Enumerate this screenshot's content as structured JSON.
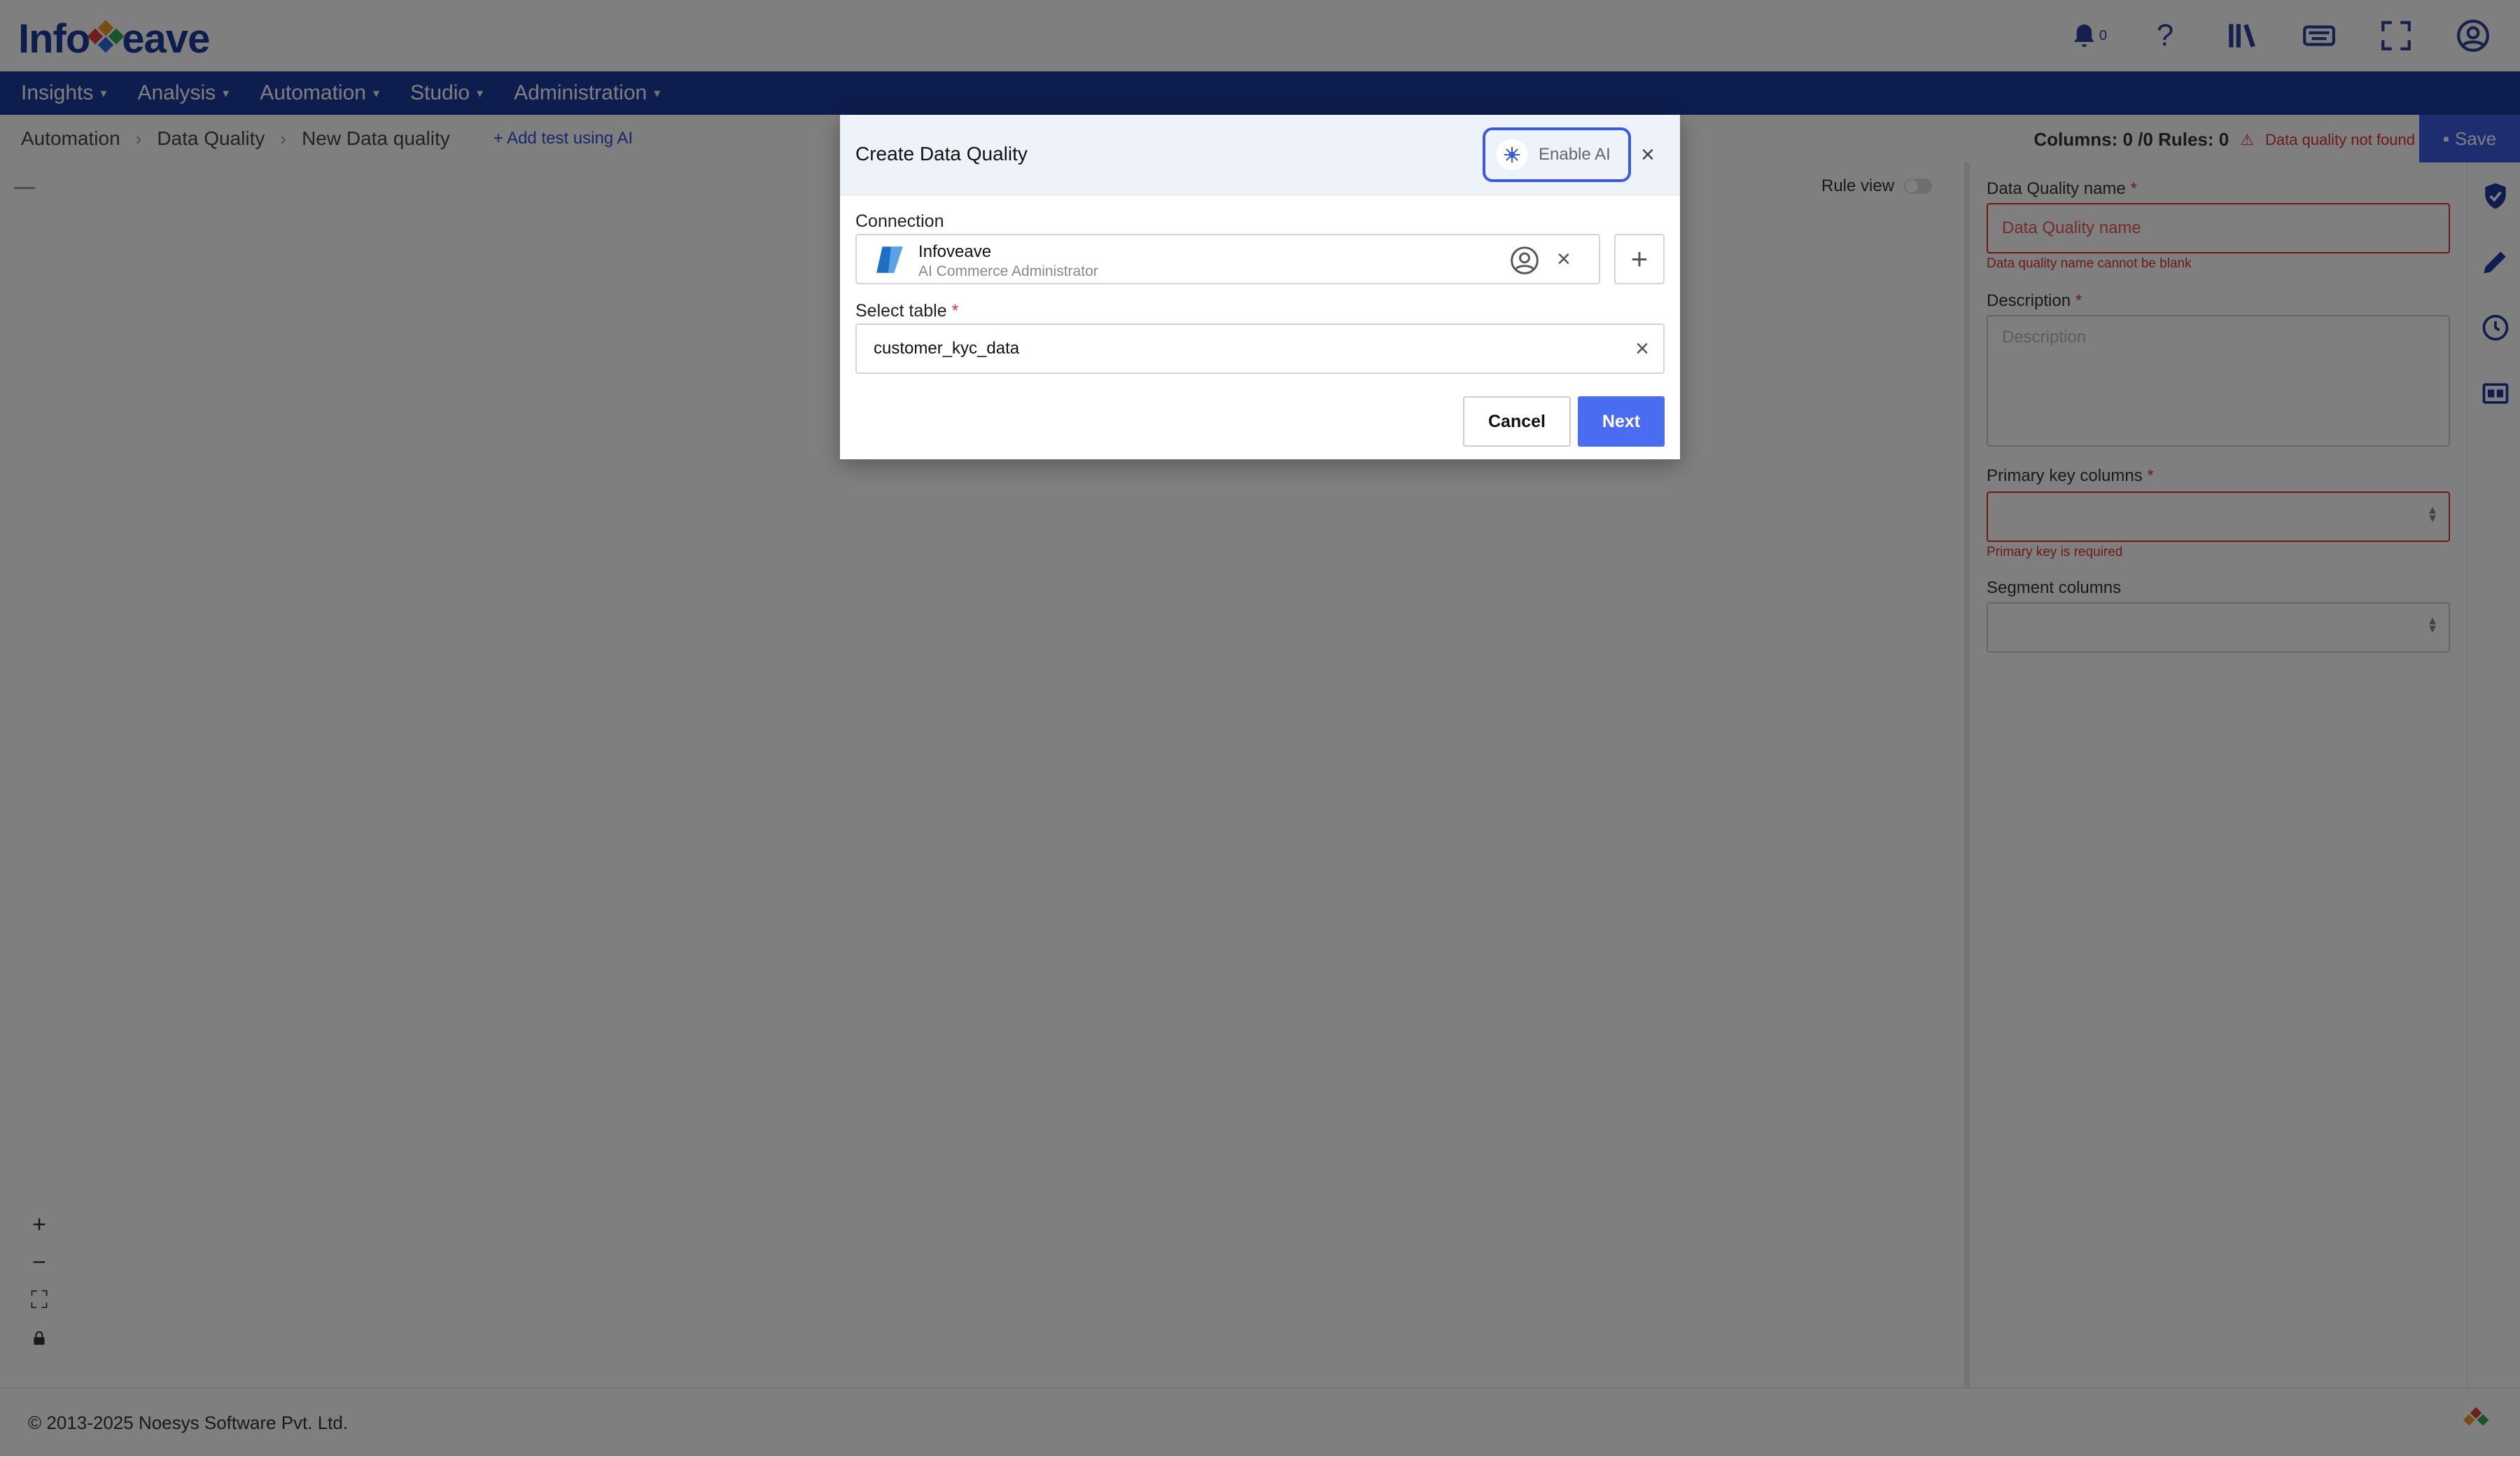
{
  "app": {
    "logo_left": "Info",
    "logo_right": "eave",
    "notification_count": "0"
  },
  "nav": {
    "items": [
      {
        "label": "Insights"
      },
      {
        "label": "Analysis"
      },
      {
        "label": "Automation"
      },
      {
        "label": "Studio"
      },
      {
        "label": "Administration"
      }
    ]
  },
  "breadcrumb": {
    "items": [
      "Automation",
      "Data Quality",
      "New Data quality"
    ],
    "ai_link": "Add test using AI"
  },
  "status": {
    "counts": "Columns: 0 /0 Rules: 0",
    "warning": "Data quality not found",
    "save_label": "Save"
  },
  "canvas": {
    "collapse": "—",
    "rule_view_label": "Rule view"
  },
  "form": {
    "name_label": "Data Quality name",
    "name_placeholder": "Data Quality name",
    "name_error": "Data quality name cannot be blank",
    "description_label": "Description",
    "description_placeholder": "Description",
    "pk_label": "Primary key columns",
    "pk_error": "Primary key is required",
    "segment_label": "Segment columns",
    "required_mark": "*"
  },
  "footer": {
    "copyright": "© 2013-2025 Noesys Software Pvt. Ltd."
  },
  "modal": {
    "title": "Create Data Quality",
    "enable_ai_label": "Enable AI",
    "close_glyph": "×",
    "connection_label": "Connection",
    "connection_name": "Infoveave",
    "connection_sub": "AI Commerce Administrator",
    "select_table_label": "Select table",
    "required_mark": "*",
    "table_value": "customer_kyc_data",
    "cancel_label": "Cancel",
    "next_label": "Next"
  },
  "colors": {
    "brand_navy": "#1b3a9c",
    "accent_blue": "#4a6cf0",
    "error_red": "#d33333"
  }
}
